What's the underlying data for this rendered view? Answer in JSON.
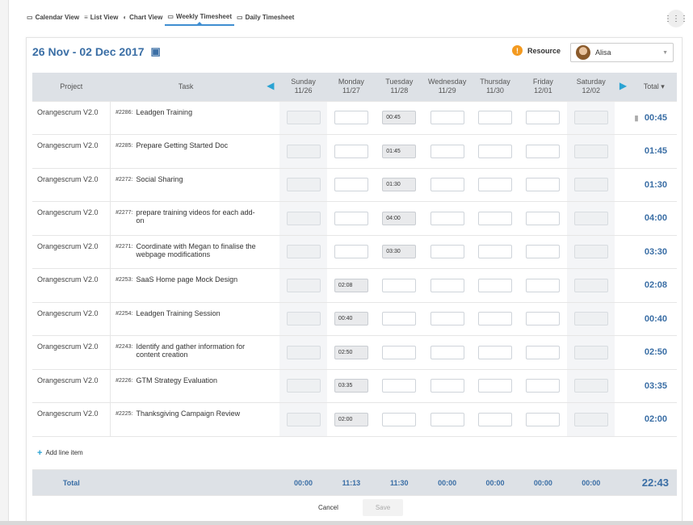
{
  "tabs": [
    {
      "icon": "calendar-icon",
      "glyph": "▭",
      "label": "Calendar View"
    },
    {
      "icon": "list-icon",
      "glyph": "≡",
      "label": "List View"
    },
    {
      "icon": "chart-icon",
      "glyph": "◐",
      "label": "Chart View"
    },
    {
      "icon": "timesheet-icon",
      "glyph": "▭",
      "label": "Weekly Timesheet",
      "active": true
    },
    {
      "icon": "timesheet-icon",
      "glyph": "▭",
      "label": "Daily Timesheet"
    }
  ],
  "header": {
    "date_range": "26 Nov - 02 Dec 2017",
    "resource_label": "Resource",
    "resource_value": "Alisa"
  },
  "columns": {
    "project": "Project",
    "task": "Task",
    "days": [
      {
        "name": "Sunday",
        "date": "11/26"
      },
      {
        "name": "Monday",
        "date": "11/27"
      },
      {
        "name": "Tuesday",
        "date": "11/28"
      },
      {
        "name": "Wednesday",
        "date": "11/29"
      },
      {
        "name": "Thursday",
        "date": "11/30"
      },
      {
        "name": "Friday",
        "date": "12/01"
      },
      {
        "name": "Saturday",
        "date": "12/02"
      }
    ],
    "total": "Total"
  },
  "rows": [
    {
      "project": "Orangescrum V2.0",
      "task_id": "#2286:",
      "task": "Leadgen Training",
      "hours": [
        "",
        "",
        "00:45",
        "",
        "",
        "",
        ""
      ],
      "total": "00:45"
    },
    {
      "project": "Orangescrum V2.0",
      "task_id": "#2285:",
      "task": "Prepare Getting Started Doc",
      "hours": [
        "",
        "",
        "01:45",
        "",
        "",
        "",
        ""
      ],
      "total": "01:45"
    },
    {
      "project": "Orangescrum V2.0",
      "task_id": "#2272:",
      "task": "Social Sharing",
      "hours": [
        "",
        "",
        "01:30",
        "",
        "",
        "",
        ""
      ],
      "total": "01:30"
    },
    {
      "project": "Orangescrum V2.0",
      "task_id": "#2277:",
      "task": "prepare training videos for each add-on",
      "hours": [
        "",
        "",
        "04:00",
        "",
        "",
        "",
        ""
      ],
      "total": "04:00"
    },
    {
      "project": "Orangescrum V2.0",
      "task_id": "#2271:",
      "task": "Coordinate with  Megan  to finalise the webpage modifications",
      "hours": [
        "",
        "",
        "03:30",
        "",
        "",
        "",
        ""
      ],
      "total": "03:30"
    },
    {
      "project": "Orangescrum V2.0",
      "task_id": "#2253:",
      "task": "SaaS Home page Mock Design",
      "hours": [
        "",
        "02:08",
        "",
        "",
        "",
        "",
        ""
      ],
      "total": "02:08"
    },
    {
      "project": "Orangescrum V2.0",
      "task_id": "#2254:",
      "task": "Leadgen Training Session",
      "hours": [
        "",
        "00:40",
        "",
        "",
        "",
        "",
        ""
      ],
      "total": "00:40"
    },
    {
      "project": "Orangescrum V2.0",
      "task_id": "#2243:",
      "task": "Identify and gather information for content creation",
      "hours": [
        "",
        "02:50",
        "",
        "",
        "",
        "",
        ""
      ],
      "total": "02:50"
    },
    {
      "project": "Orangescrum V2.0",
      "task_id": "#2226:",
      "task": "GTM Strategy Evaluation",
      "hours": [
        "",
        "03:35",
        "",
        "",
        "",
        "",
        ""
      ],
      "total": "03:35"
    },
    {
      "project": "Orangescrum V2.0",
      "task_id": "#2225:",
      "task": "Thanksgiving Campaign Review",
      "hours": [
        "",
        "02:00",
        "",
        "",
        "",
        "",
        ""
      ],
      "total": "02:00"
    }
  ],
  "add_line_label": "Add line item",
  "footer": {
    "label": "Total",
    "day_totals": [
      "00:00",
      "11:13",
      "11:30",
      "00:00",
      "00:00",
      "00:00",
      "00:00"
    ],
    "grand_total": "22:43"
  },
  "actions": {
    "cancel": "Cancel",
    "save": "Save"
  },
  "colors": {
    "accent": "#3a6ea5",
    "arrow": "#2aa3d3",
    "info": "#f39a20"
  }
}
